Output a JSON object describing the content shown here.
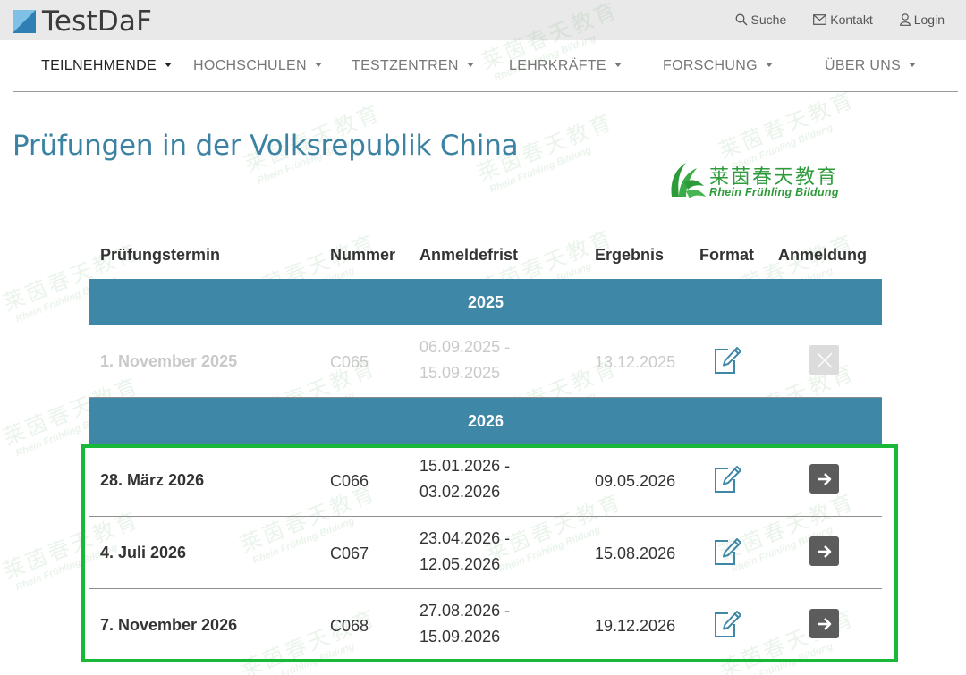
{
  "site": {
    "name": "TestDaF"
  },
  "top_links": [
    {
      "label": "Suche",
      "icon": "search-icon"
    },
    {
      "label": "Kontakt",
      "icon": "mail-icon"
    },
    {
      "label": "Login",
      "icon": "user-icon"
    }
  ],
  "nav": [
    {
      "label": "TEILNEHMENDE",
      "active": true
    },
    {
      "label": "HOCHSCHULEN",
      "active": false
    },
    {
      "label": "TESTZENTREN",
      "active": false
    },
    {
      "label": "LEHRKRÄFTE",
      "active": false
    },
    {
      "label": "FORSCHUNG",
      "active": false
    },
    {
      "label": "ÜBER UNS",
      "active": false
    }
  ],
  "page_title": "Prüfungen in der Volksrepublik China",
  "brand": {
    "cn": "莱茵春天教育",
    "en": "Rhein Frühling Bildung"
  },
  "watermark": {
    "cn": "莱茵春天教育",
    "en": "Rhein Frühling Bildung"
  },
  "table": {
    "headers": [
      "Prüfungstermin",
      "Nummer",
      "Anmeldefrist",
      "Ergebnis",
      "Format",
      "Anmeldung"
    ],
    "groups": [
      {
        "year": "2025",
        "rows": [
          {
            "date": "1. November 2025",
            "number": "C065",
            "deadline_from": "06.09.2025 -",
            "deadline_to": "15.09.2025",
            "result": "13.12.2025",
            "registration_open": false
          }
        ]
      },
      {
        "year": "2026",
        "rows": [
          {
            "date": "28. März 2026",
            "number": "C066",
            "deadline_from": "15.01.2026 -",
            "deadline_to": "03.02.2026",
            "result": "09.05.2026",
            "registration_open": true
          },
          {
            "date": "4. Juli 2026",
            "number": "C067",
            "deadline_from": "23.04.2026 -",
            "deadline_to": "12.05.2026",
            "result": "15.08.2026",
            "registration_open": true
          },
          {
            "date": "7. November 2026",
            "number": "C068",
            "deadline_from": "27.08.2026 -",
            "deadline_to": "15.09.2026",
            "result": "19.12.2026",
            "registration_open": true
          }
        ]
      }
    ]
  },
  "colors": {
    "accent": "#3e87a6",
    "title": "#3c82a3",
    "highlight": "#18b838",
    "brand_green": "#2d9b3a"
  }
}
